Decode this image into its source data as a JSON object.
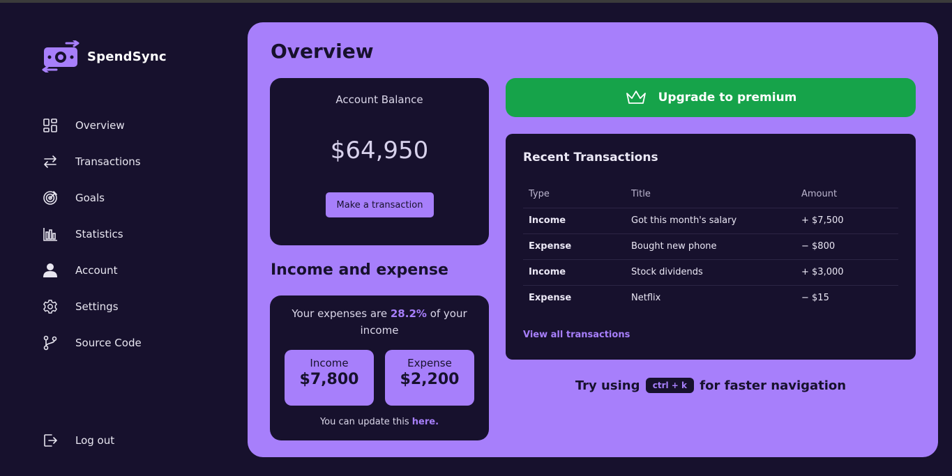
{
  "app": {
    "name": "SpendSync"
  },
  "sidebar": {
    "items": [
      {
        "label": "Overview",
        "icon": "overview-grid-icon"
      },
      {
        "label": "Transactions",
        "icon": "arrows-swap-icon"
      },
      {
        "label": "Goals",
        "icon": "target-icon"
      },
      {
        "label": "Statistics",
        "icon": "bar-chart-icon"
      },
      {
        "label": "Account",
        "icon": "user-icon"
      },
      {
        "label": "Settings",
        "icon": "gear-icon"
      },
      {
        "label": "Source Code",
        "icon": "git-branch-icon"
      }
    ],
    "logout_label": "Log out"
  },
  "main": {
    "title": "Overview",
    "balance": {
      "label": "Account Balance",
      "amount": "$64,950",
      "button_label": "Make a transaction"
    },
    "income_expense": {
      "title": "Income and expense",
      "text_before": "Your expenses are ",
      "percent": "28.2%",
      "text_after": " of your income",
      "income_label": "Income",
      "income_value": "$7,800",
      "expense_label": "Expense",
      "expense_value": "$2,200",
      "footer_text": "You can update this ",
      "footer_link": "here."
    },
    "premium": {
      "label": "Upgrade to premium"
    },
    "recent": {
      "title": "Recent Transactions",
      "columns": [
        "Type",
        "Title",
        "Amount"
      ],
      "rows": [
        {
          "type": "Income",
          "title": "Got this month's salary",
          "amount": "+ $7,500"
        },
        {
          "type": "Expense",
          "title": "Bought new phone",
          "amount": "− $800"
        },
        {
          "type": "Income",
          "title": "Stock dividends",
          "amount": "+ $3,000"
        },
        {
          "type": "Expense",
          "title": "Netflix",
          "amount": "− $15"
        }
      ],
      "view_all_label": "View all transactions"
    },
    "tip": {
      "before": "Try using ",
      "shortcut": "ctrl + k",
      "after": " for faster navigation"
    }
  },
  "colors": {
    "background": "#17112d",
    "accent": "#a77ffb",
    "premium": "#16a34a"
  }
}
